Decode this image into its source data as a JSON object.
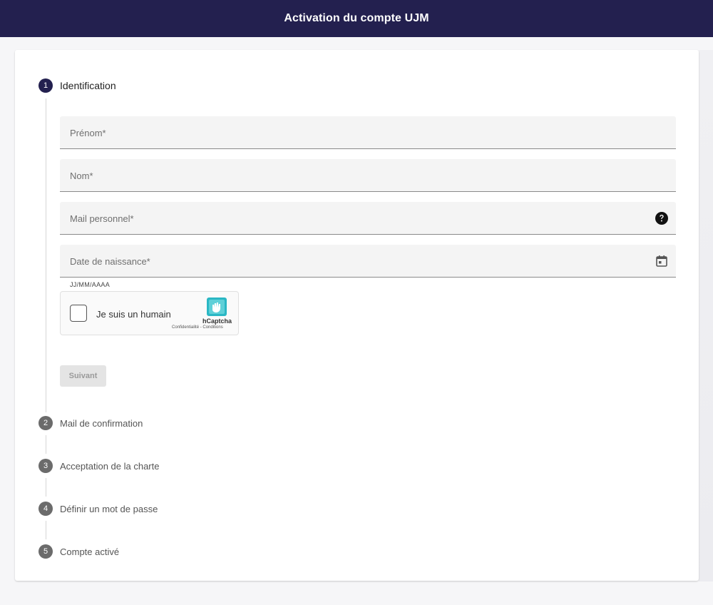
{
  "header": {
    "title": "Activation du compte UJM"
  },
  "steps": [
    {
      "number": "1",
      "label": "Identification",
      "active": true
    },
    {
      "number": "2",
      "label": "Mail de confirmation",
      "active": false
    },
    {
      "number": "3",
      "label": "Acceptation de la charte",
      "active": false
    },
    {
      "number": "4",
      "label": "Définir un mot de passe",
      "active": false
    },
    {
      "number": "5",
      "label": "Compte activé",
      "active": false
    }
  ],
  "form": {
    "firstname": {
      "label": "Prénom*",
      "value": ""
    },
    "lastname": {
      "label": "Nom*",
      "value": ""
    },
    "email": {
      "label": "Mail personnel*",
      "value": "",
      "icon": "help-icon"
    },
    "birthdate": {
      "label": "Date de naissance*",
      "value": "",
      "hint": "JJ/MM/AAAA",
      "icon": "calendar-icon"
    }
  },
  "captcha": {
    "checkbox_label": "Je suis un humain",
    "brand": "hCaptcha",
    "links": "Confidentialité - Conditions"
  },
  "buttons": {
    "next_label": "Suivant"
  },
  "colors": {
    "primary": "#23204f",
    "inactive_step": "#6b6b6b",
    "captcha_accent": "#2ab7c4"
  }
}
